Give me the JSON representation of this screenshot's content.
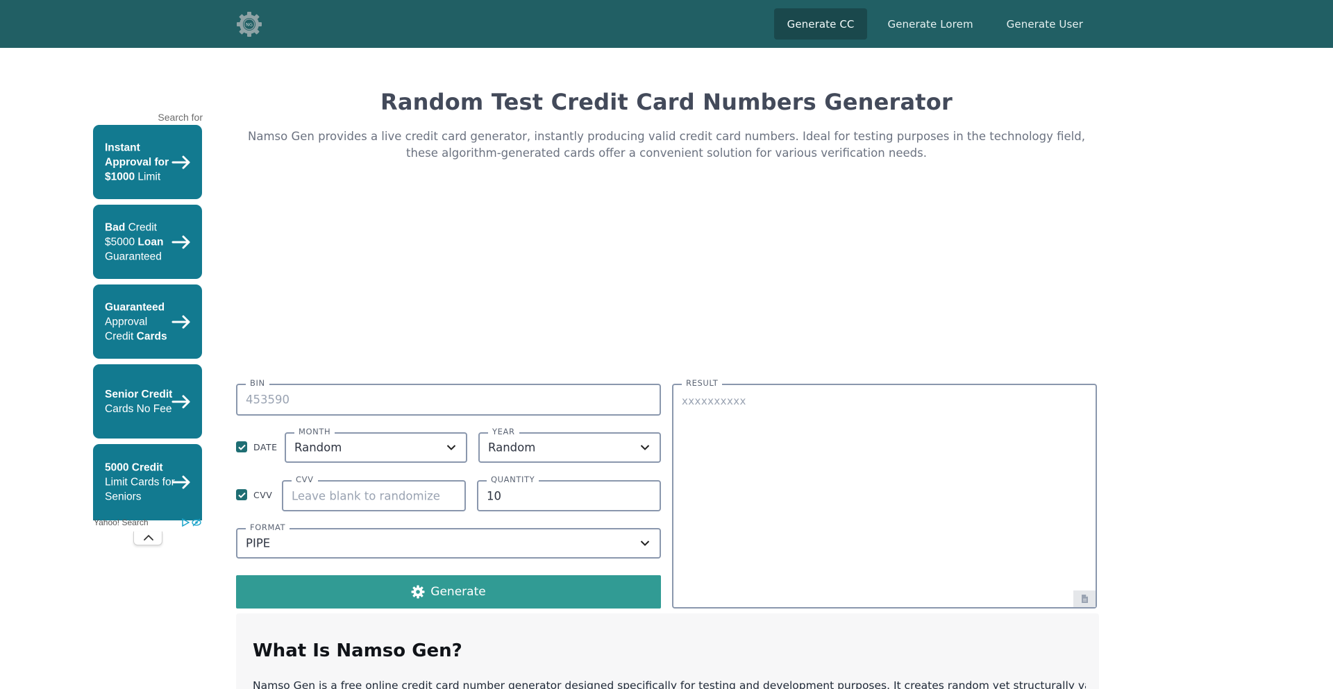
{
  "header": {
    "logo_text": "NG",
    "nav": [
      "Generate CC",
      "Generate Lorem",
      "Generate User"
    ],
    "active_nav": "Generate CC",
    "bg_color": "#215f64"
  },
  "ad": {
    "search_for": "Search for",
    "items": [
      [
        {
          "t": "Instant Approval for ",
          "b": true
        },
        {
          "t": "$1000",
          "b": true
        },
        {
          "t": " Limit",
          "b": false
        }
      ],
      [
        {
          "t": "Bad",
          "b": true
        },
        {
          "t": " Credit $5000 ",
          "b": false
        },
        {
          "t": "Loan",
          "b": true
        },
        {
          "t": " Guaranteed",
          "b": false
        }
      ],
      [
        {
          "t": "Guaranteed",
          "b": true
        },
        {
          "t": " Approval Credit ",
          "b": false
        },
        {
          "t": "Cards",
          "b": true
        }
      ],
      [
        {
          "t": "Senior Credit",
          "b": true
        },
        {
          "t": " Cards No Fee",
          "b": false
        }
      ],
      [
        {
          "t": "5000 Credit",
          "b": true
        },
        {
          "t": " Limit Cards for Seniors",
          "b": false
        }
      ]
    ],
    "footer": "Yahoo! Search",
    "accent": "#127a90"
  },
  "hero": {
    "title": "Random Test Credit Card Numbers Generator",
    "subtitle": "Namso Gen provides a live credit card generator, instantly producing valid credit card numbers. Ideal for testing purposes in the technology field, these algorithm-generated cards offer a convenient solution for various verification needs."
  },
  "form": {
    "bin": {
      "label": "BIN",
      "placeholder": "453590"
    },
    "date": {
      "label": "DATE",
      "checked": true
    },
    "month": {
      "label": "MONTH",
      "value": "Random"
    },
    "year": {
      "label": "YEAR",
      "value": "Random"
    },
    "cvv_check": {
      "label": "CVV",
      "checked": true
    },
    "cvv": {
      "label": "CVV",
      "placeholder": "Leave blank to randomize"
    },
    "quantity": {
      "label": "QUANTITY",
      "value": "10"
    },
    "format": {
      "label": "FORMAT",
      "value": "PIPE"
    },
    "generate_label": "Generate",
    "button_color": "#319b94"
  },
  "result": {
    "label": "RESULT",
    "placeholder": "xxxxxxxxxx"
  },
  "about": {
    "heading": "What Is Namso Gen?",
    "text": "Namso Gen is a free online credit card number generator designed specifically for testing and development purposes. It creates random yet structurally valid"
  }
}
